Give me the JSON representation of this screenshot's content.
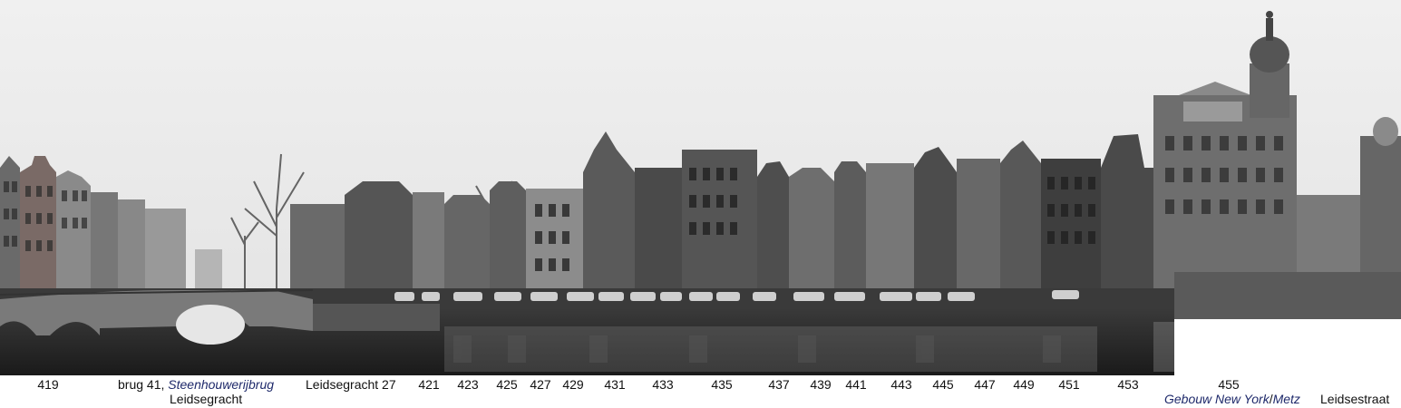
{
  "labels": {
    "n419": "419",
    "brug_prefix": "brug 41, ",
    "brug_name": "Steenhouwerijbrug",
    "leidsegracht": "Leidsegracht",
    "leidsegracht27": "Leidsegracht 27",
    "n421": "421",
    "n423": "423",
    "n425": "425",
    "n427": "427",
    "n429": "429",
    "n431": "431",
    "n433": "433",
    "n435": "435",
    "n437": "437",
    "n439": "439",
    "n441": "441",
    "n443": "443",
    "n445": "445",
    "n447": "447",
    "n449": "449",
    "n451": "451",
    "n453": "453",
    "n455": "455",
    "gebouw": "Gebouw New York",
    "slash": "/",
    "metz": "Metz",
    "leidsestraat": "Leidsestraat"
  },
  "colors": {
    "sky": "#ececec",
    "water": "#2a2a2a",
    "label_blue": "#1f2a6b"
  }
}
